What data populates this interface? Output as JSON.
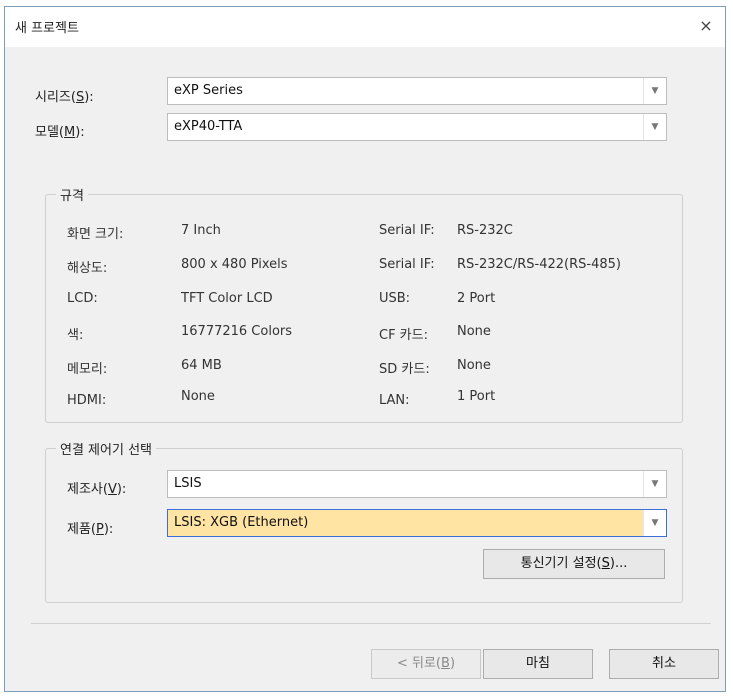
{
  "window": {
    "title": "새 프로젝트",
    "close": "×"
  },
  "series": {
    "label": "시리즈(",
    "key": "S",
    "label_end": "):",
    "value": "eXP Series"
  },
  "model": {
    "label": "모델(",
    "key": "M",
    "label_end": "):",
    "value": "eXP40-TTA"
  },
  "spec": {
    "legend": "규격",
    "left": [
      {
        "label": "화면 크기:",
        "value": "7 Inch"
      },
      {
        "label": "해상도:",
        "value": "800 x 480 Pixels"
      },
      {
        "label": "LCD:",
        "value": "TFT Color LCD"
      },
      {
        "label": "색:",
        "value": "16777216 Colors"
      },
      {
        "label": "메모리:",
        "value": "64 MB"
      },
      {
        "label": "HDMI:",
        "value": "None"
      }
    ],
    "right": [
      {
        "label": "Serial IF:",
        "value": "RS-232C"
      },
      {
        "label": "Serial IF:",
        "value": "RS-232C/RS-422(RS-485)"
      },
      {
        "label": "USB:",
        "value": "2 Port"
      },
      {
        "label": "CF 카드:",
        "value": "None"
      },
      {
        "label": "SD 카드:",
        "value": "None"
      },
      {
        "label": "LAN:",
        "value": "1 Port"
      }
    ]
  },
  "controller": {
    "legend": "연결 제어기 선택",
    "maker": {
      "label": "제조사(",
      "key": "V",
      "label_end": "):",
      "value": "LSIS"
    },
    "product": {
      "label": "제품(",
      "key": "P",
      "label_end": "):",
      "value": "LSIS: XGB (Ethernet)"
    },
    "comm_button": {
      "text": "통신기기 설정(",
      "key": "S",
      "text_end": ")..."
    }
  },
  "footer": {
    "back": {
      "text": "< 뒤로(",
      "key": "B",
      "text_end": ")"
    },
    "finish": "마침",
    "cancel": "취소"
  },
  "colors": {
    "highlight": "#ffe4a3",
    "border": "#7f9db9"
  }
}
